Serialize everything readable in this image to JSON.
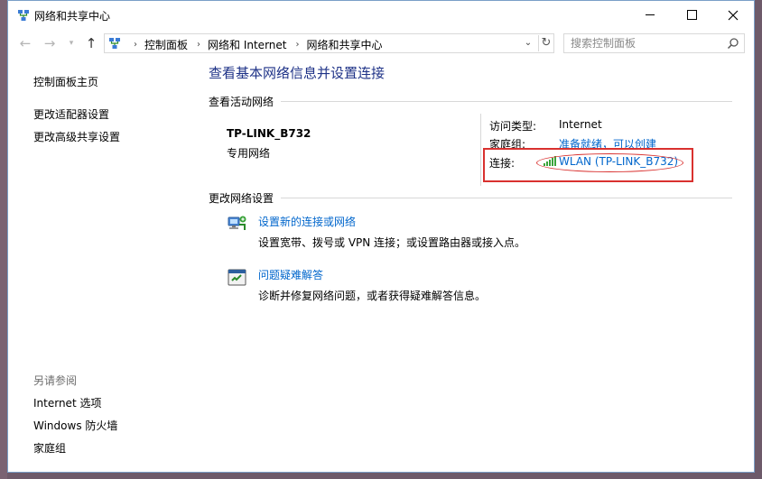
{
  "window": {
    "title": "网络和共享中心"
  },
  "nav": {
    "breadcrumbs": [
      "控制面板",
      "网络和 Internet",
      "网络和共享中心"
    ],
    "search_placeholder": "搜索控制面板"
  },
  "sidebar": {
    "links": [
      "控制面板主页",
      "更改适配器设置",
      "更改高级共享设置"
    ],
    "see_also_heading": "另请参阅",
    "see_also_links": [
      "Internet 选项",
      "Windows 防火墙",
      "家庭组"
    ]
  },
  "main": {
    "title": "查看基本网络信息并设置连接",
    "active_networks_heading": "查看活动网络",
    "network": {
      "name": "TP-LINK_B732",
      "type": "专用网络",
      "access_type_label": "访问类型:",
      "access_type_value": "Internet",
      "homegroup_label": "家庭组:",
      "homegroup_value": "准备就绪，可以创建",
      "connections_label": "连接:",
      "connection_value": "WLAN (TP-LINK_B732)"
    },
    "change_settings_heading": "更改网络设置",
    "tasks": [
      {
        "title": "设置新的连接或网络",
        "description": "设置宽带、拨号或 VPN 连接；或设置路由器或接入点。",
        "icon": "new-connection-icon"
      },
      {
        "title": "问题疑难解答",
        "description": "诊断并修复网络问题，或者获得疑难解答信息。",
        "icon": "troubleshoot-icon"
      }
    ]
  },
  "colors": {
    "heading_blue": "#1e3287",
    "link_blue": "#0066cc",
    "highlight_red": "#d9312f"
  }
}
